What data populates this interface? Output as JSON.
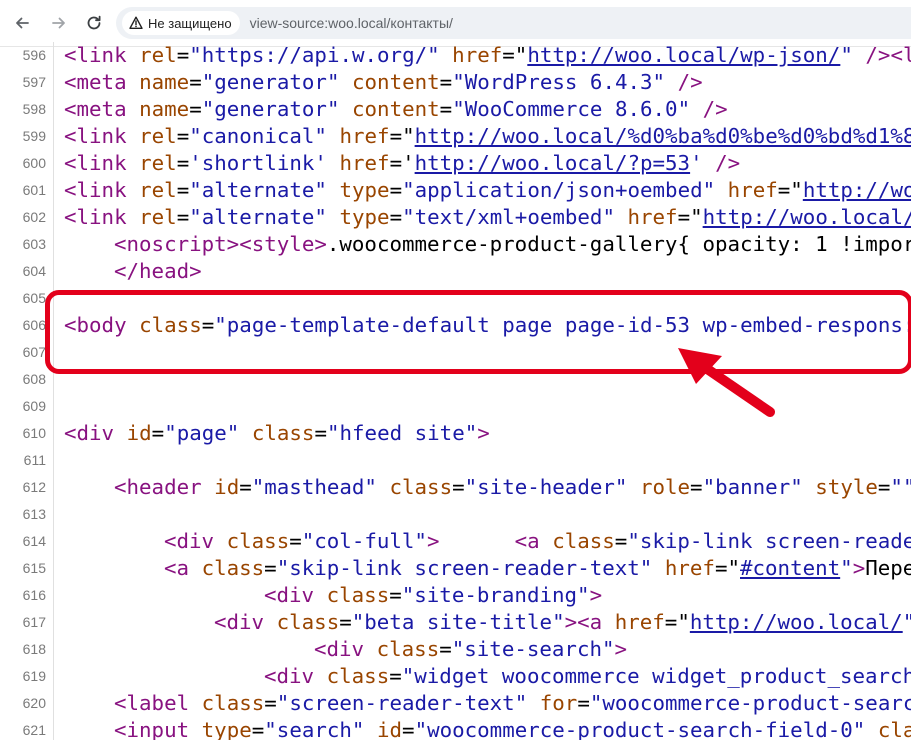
{
  "browser": {
    "security_label": "Не защищено",
    "url": "view-source:woo.local/контакты/"
  },
  "colors": {
    "tag": "#881280",
    "attr_name": "#994500",
    "attr_value": "#1a1aa6",
    "annotation": "#e3001b"
  },
  "source_lines": [
    {
      "num": "596",
      "indent": 0,
      "tokens": [
        [
          "t",
          "<link "
        ],
        [
          "an",
          "rel"
        ],
        [
          "tx",
          "="
        ],
        [
          "av",
          "\"https://api.w.org/\""
        ],
        [
          "tx",
          " "
        ],
        [
          "an",
          "href"
        ],
        [
          "tx",
          "=\""
        ],
        [
          "lk",
          "http://woo.local/wp-json/"
        ],
        [
          "av",
          "\""
        ],
        [
          "tx",
          " "
        ],
        [
          "t",
          "/><l"
        ]
      ]
    },
    {
      "num": "597",
      "indent": 0,
      "tokens": [
        [
          "t",
          "<meta "
        ],
        [
          "an",
          "name"
        ],
        [
          "tx",
          "="
        ],
        [
          "av",
          "\"generator\""
        ],
        [
          "tx",
          " "
        ],
        [
          "an",
          "content"
        ],
        [
          "tx",
          "="
        ],
        [
          "av",
          "\"WordPress 6.4.3\""
        ],
        [
          "tx",
          " "
        ],
        [
          "t",
          "/>"
        ]
      ]
    },
    {
      "num": "598",
      "indent": 0,
      "tokens": [
        [
          "t",
          "<meta "
        ],
        [
          "an",
          "name"
        ],
        [
          "tx",
          "="
        ],
        [
          "av",
          "\"generator\""
        ],
        [
          "tx",
          " "
        ],
        [
          "an",
          "content"
        ],
        [
          "tx",
          "="
        ],
        [
          "av",
          "\"WooCommerce 8.6.0\""
        ],
        [
          "tx",
          " "
        ],
        [
          "t",
          "/>"
        ]
      ]
    },
    {
      "num": "599",
      "indent": 0,
      "tokens": [
        [
          "t",
          "<link "
        ],
        [
          "an",
          "rel"
        ],
        [
          "tx",
          "="
        ],
        [
          "av",
          "\"canonical\""
        ],
        [
          "tx",
          " "
        ],
        [
          "an",
          "href"
        ],
        [
          "tx",
          "=\""
        ],
        [
          "lk",
          "http://woo.local/%d0%ba%d0%be%d0%bd%d1%8"
        ]
      ]
    },
    {
      "num": "600",
      "indent": 0,
      "tokens": [
        [
          "t",
          "<link "
        ],
        [
          "an",
          "rel"
        ],
        [
          "tx",
          "="
        ],
        [
          "av",
          "'shortlink'"
        ],
        [
          "tx",
          " "
        ],
        [
          "an",
          "href"
        ],
        [
          "tx",
          "='"
        ],
        [
          "lk",
          "http://woo.local/?p=53"
        ],
        [
          "av",
          "'"
        ],
        [
          "tx",
          " "
        ],
        [
          "t",
          "/>"
        ]
      ]
    },
    {
      "num": "601",
      "indent": 0,
      "tokens": [
        [
          "t",
          "<link "
        ],
        [
          "an",
          "rel"
        ],
        [
          "tx",
          "="
        ],
        [
          "av",
          "\"alternate\""
        ],
        [
          "tx",
          " "
        ],
        [
          "an",
          "type"
        ],
        [
          "tx",
          "="
        ],
        [
          "av",
          "\"application/json+oembed\""
        ],
        [
          "tx",
          " "
        ],
        [
          "an",
          "href"
        ],
        [
          "tx",
          "=\""
        ],
        [
          "lk",
          "http://wo"
        ]
      ]
    },
    {
      "num": "602",
      "indent": 0,
      "tokens": [
        [
          "t",
          "<link "
        ],
        [
          "an",
          "rel"
        ],
        [
          "tx",
          "="
        ],
        [
          "av",
          "\"alternate\""
        ],
        [
          "tx",
          " "
        ],
        [
          "an",
          "type"
        ],
        [
          "tx",
          "="
        ],
        [
          "av",
          "\"text/xml+oembed\""
        ],
        [
          "tx",
          " "
        ],
        [
          "an",
          "href"
        ],
        [
          "tx",
          "=\""
        ],
        [
          "lk",
          "http://woo.local/"
        ]
      ]
    },
    {
      "num": "603",
      "indent": 1,
      "tokens": [
        [
          "t",
          "<noscript>"
        ],
        [
          "t",
          "<style>"
        ],
        [
          "tx",
          ".woocommerce-product-gallery{ opacity: 1 !impor"
        ]
      ]
    },
    {
      "num": "604",
      "indent": 1,
      "tokens": [
        [
          "t",
          "</head>"
        ]
      ]
    },
    {
      "num": "605",
      "indent": 0,
      "tokens": []
    },
    {
      "num": "606",
      "indent": 0,
      "tokens": [
        [
          "t",
          "<body "
        ],
        [
          "an",
          "class"
        ],
        [
          "tx",
          "="
        ],
        [
          "av",
          "\"page-template-default page page-id-53 wp-embed-respons:"
        ]
      ]
    },
    {
      "num": "607",
      "indent": 0,
      "tokens": []
    },
    {
      "num": "608",
      "indent": 0,
      "tokens": []
    },
    {
      "num": "609",
      "indent": 0,
      "tokens": []
    },
    {
      "num": "610",
      "indent": 0,
      "tokens": [
        [
          "t",
          "<div "
        ],
        [
          "an",
          "id"
        ],
        [
          "tx",
          "="
        ],
        [
          "av",
          "\"page\""
        ],
        [
          "tx",
          " "
        ],
        [
          "an",
          "class"
        ],
        [
          "tx",
          "="
        ],
        [
          "av",
          "\"hfeed site\""
        ],
        [
          "t",
          ">"
        ]
      ]
    },
    {
      "num": "611",
      "indent": 0,
      "tokens": []
    },
    {
      "num": "612",
      "indent": 1,
      "tokens": [
        [
          "t",
          "<header "
        ],
        [
          "an",
          "id"
        ],
        [
          "tx",
          "="
        ],
        [
          "av",
          "\"masthead\""
        ],
        [
          "tx",
          " "
        ],
        [
          "an",
          "class"
        ],
        [
          "tx",
          "="
        ],
        [
          "av",
          "\"site-header\""
        ],
        [
          "tx",
          " "
        ],
        [
          "an",
          "role"
        ],
        [
          "tx",
          "="
        ],
        [
          "av",
          "\"banner\""
        ],
        [
          "tx",
          " "
        ],
        [
          "an",
          "style"
        ],
        [
          "tx",
          "="
        ],
        [
          "av",
          "\"\""
        ]
      ]
    },
    {
      "num": "613",
      "indent": 0,
      "tokens": []
    },
    {
      "num": "614",
      "indent": 2,
      "tokens": [
        [
          "t",
          "<div "
        ],
        [
          "an",
          "class"
        ],
        [
          "tx",
          "="
        ],
        [
          "av",
          "\"col-full\""
        ],
        [
          "t",
          ">"
        ],
        [
          "tx",
          "      "
        ],
        [
          "t",
          "<a "
        ],
        [
          "an",
          "class"
        ],
        [
          "tx",
          "="
        ],
        [
          "av",
          "\"skip-link screen-reade"
        ]
      ]
    },
    {
      "num": "615",
      "indent": 2,
      "tokens": [
        [
          "t",
          "<a "
        ],
        [
          "an",
          "class"
        ],
        [
          "tx",
          "="
        ],
        [
          "av",
          "\"skip-link screen-reader-text\""
        ],
        [
          "tx",
          " "
        ],
        [
          "an",
          "href"
        ],
        [
          "tx",
          "=\""
        ],
        [
          "lk",
          "#content"
        ],
        [
          "av",
          "\""
        ],
        [
          "t",
          ">"
        ],
        [
          "tx",
          "Пере"
        ]
      ]
    },
    {
      "num": "616",
      "indent": 4,
      "tokens": [
        [
          "t",
          "<div "
        ],
        [
          "an",
          "class"
        ],
        [
          "tx",
          "="
        ],
        [
          "av",
          "\"site-branding\""
        ],
        [
          "t",
          ">"
        ]
      ]
    },
    {
      "num": "617",
      "indent": 3,
      "tokens": [
        [
          "t",
          "<div "
        ],
        [
          "an",
          "class"
        ],
        [
          "tx",
          "="
        ],
        [
          "av",
          "\"beta site-title\""
        ],
        [
          "t",
          ">"
        ],
        [
          "t",
          "<a "
        ],
        [
          "an",
          "href"
        ],
        [
          "tx",
          "=\""
        ],
        [
          "lk",
          "http://woo.local/"
        ],
        [
          "av",
          "\""
        ]
      ]
    },
    {
      "num": "618",
      "indent": 5,
      "tokens": [
        [
          "t",
          "<div "
        ],
        [
          "an",
          "class"
        ],
        [
          "tx",
          "="
        ],
        [
          "av",
          "\"site-search\""
        ],
        [
          "t",
          ">"
        ]
      ]
    },
    {
      "num": "619",
      "indent": 4,
      "tokens": [
        [
          "t",
          "<div "
        ],
        [
          "an",
          "class"
        ],
        [
          "tx",
          "="
        ],
        [
          "av",
          "\"widget woocommerce widget_product_search"
        ]
      ]
    },
    {
      "num": "620",
      "indent": 1,
      "tokens": [
        [
          "t",
          "<label "
        ],
        [
          "an",
          "class"
        ],
        [
          "tx",
          "="
        ],
        [
          "av",
          "\"screen-reader-text\""
        ],
        [
          "tx",
          " "
        ],
        [
          "an",
          "for"
        ],
        [
          "tx",
          "="
        ],
        [
          "av",
          "\"woocommerce-product-searc"
        ]
      ]
    },
    {
      "num": "621",
      "indent": 1,
      "tokens": [
        [
          "t",
          "<input "
        ],
        [
          "an",
          "type"
        ],
        [
          "tx",
          "="
        ],
        [
          "av",
          "\"search\""
        ],
        [
          "tx",
          " "
        ],
        [
          "an",
          "id"
        ],
        [
          "tx",
          "="
        ],
        [
          "av",
          "\"woocommerce-product-search-field-0\""
        ],
        [
          "tx",
          " "
        ],
        [
          "an",
          "cla"
        ]
      ]
    }
  ]
}
